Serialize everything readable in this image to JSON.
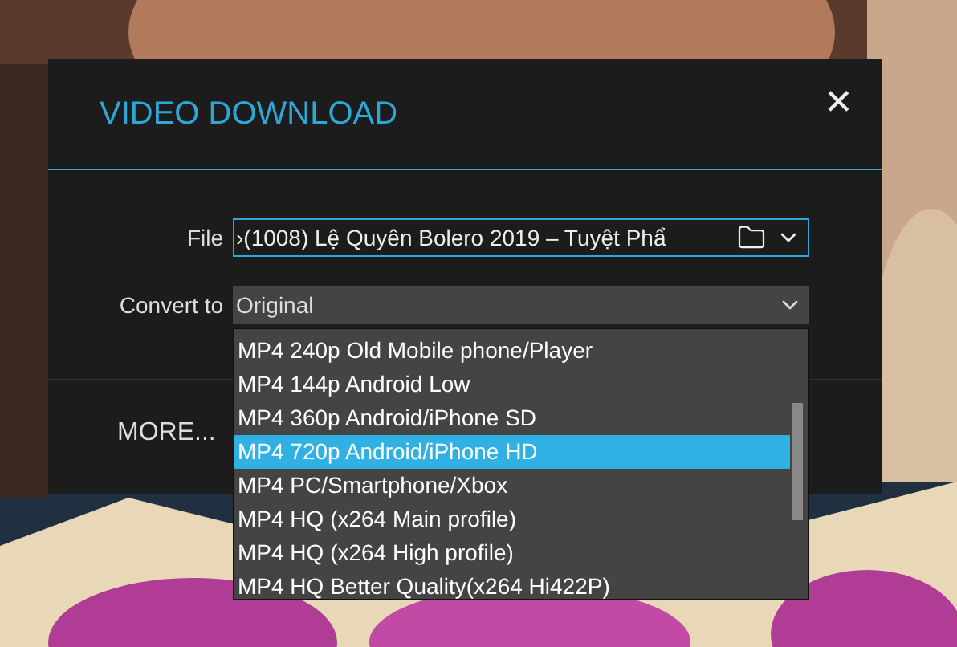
{
  "dialog": {
    "title": "VIDEO DOWNLOAD",
    "close": "✕"
  },
  "file": {
    "label": "File",
    "value": "›(1008) Lệ Quyên Bolero 2019 – Tuyệt Phẩ"
  },
  "convert": {
    "label": "Convert to",
    "value": "Original",
    "options": [
      {
        "label": "MP4 240p Old Mobile phone/Player",
        "selected": false
      },
      {
        "label": "MP4 144p Android Low",
        "selected": false
      },
      {
        "label": "MP4 360p Android/iPhone SD",
        "selected": false
      },
      {
        "label": "MP4 720p Android/iPhone HD",
        "selected": true
      },
      {
        "label": "MP4 PC/Smartphone/Xbox",
        "selected": false
      },
      {
        "label": "MP4 HQ (x264 Main profile)",
        "selected": false
      },
      {
        "label": "MP4 HQ (x264 High profile)",
        "selected": false
      },
      {
        "label": "MP4 HQ Better Quality(x264 Hi422P)",
        "selected": false
      }
    ]
  },
  "more_button": "MORE..."
}
